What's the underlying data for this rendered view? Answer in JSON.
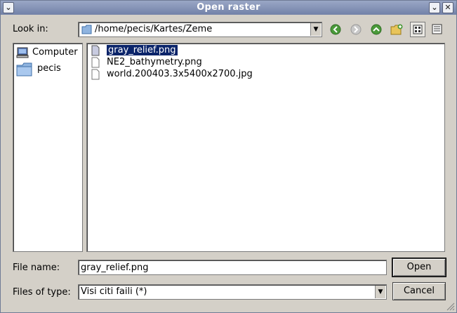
{
  "window": {
    "title": "Open raster"
  },
  "toolbar": {
    "look_in_label": "Look in:",
    "path": "/home/pecis/Kartes/Zeme",
    "icons": [
      "back-icon",
      "forward-icon",
      "up-icon",
      "new-folder-icon",
      "list-view-icon",
      "detail-view-icon"
    ]
  },
  "places": [
    {
      "label": "Computer",
      "icon": "computer-icon"
    },
    {
      "label": "pecis",
      "icon": "folder-icon"
    }
  ],
  "files": [
    {
      "name": "gray_relief.png",
      "selected": true
    },
    {
      "name": "NE2_bathymetry.png",
      "selected": false
    },
    {
      "name": "world.200403.3x5400x2700.jpg",
      "selected": false
    }
  ],
  "form": {
    "file_name_label": "File name:",
    "file_name_value": "gray_relief.png",
    "file_type_label": "Files of type:",
    "file_type_value": "Visi citi faili (*)",
    "open_label": "Open",
    "cancel_label": "Cancel"
  },
  "colors": {
    "titlebar": "#7a88ad",
    "selection": "#0a246a",
    "dialog_bg": "#d4d0c8"
  }
}
